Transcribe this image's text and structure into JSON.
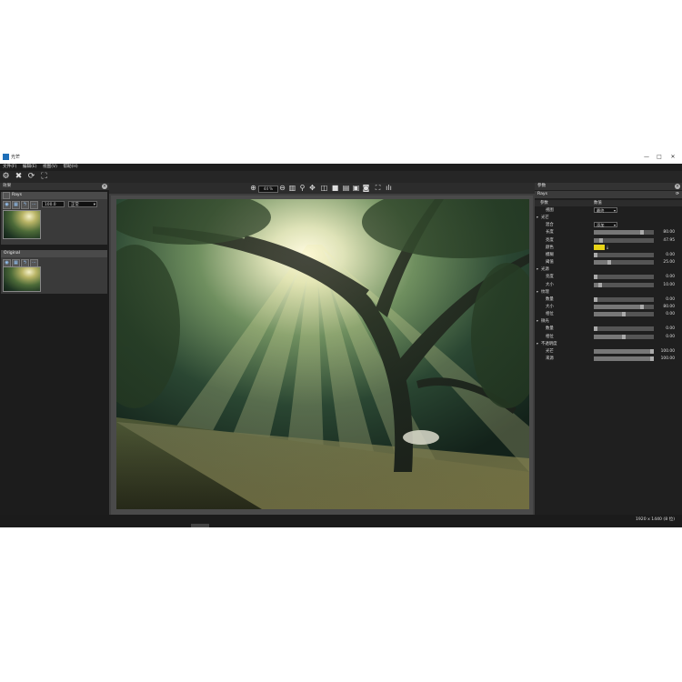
{
  "window": {
    "title": "光芒",
    "controls": {
      "minimize": "—",
      "maximize": "□",
      "close": "✕"
    }
  },
  "menu": [
    "文件(F)",
    "编辑(E)",
    "视图(V)",
    "帮助(H)"
  ],
  "effects_panel": {
    "title": "效果",
    "layers": [
      {
        "name": "Rays",
        "opacity": "100.0",
        "blend": "正常"
      },
      {
        "name": "Original"
      }
    ]
  },
  "view": {
    "zoom": "44 %"
  },
  "params_panel": {
    "title": "参数",
    "subtitle": "Rays",
    "header_left": "参数",
    "header_right": "数值",
    "rows": [
      {
        "indent": 1,
        "label": "视图",
        "type": "dropdown",
        "value": "最终"
      },
      {
        "indent": 0,
        "label": "光芒",
        "type": "group"
      },
      {
        "indent": 1,
        "label": "混合",
        "type": "dropdown",
        "value": "添加"
      },
      {
        "indent": 1,
        "label": "长度",
        "type": "slider",
        "value": "80.00",
        "pct": 0.8
      },
      {
        "indent": 1,
        "label": "亮度",
        "type": "slider",
        "value": "47.95",
        "pct": 0.12
      },
      {
        "indent": 1,
        "label": "颜色",
        "type": "color",
        "value": "#e8d417"
      },
      {
        "indent": 1,
        "label": "模糊",
        "type": "slider",
        "value": "0.00",
        "pct": 0.0
      },
      {
        "indent": 1,
        "label": "阈值",
        "type": "slider",
        "value": "25.00",
        "pct": 0.25
      },
      {
        "indent": 0,
        "label": "光源",
        "type": "group"
      },
      {
        "indent": 1,
        "label": "亮度",
        "type": "slider",
        "value": "0.00",
        "pct": 0.0
      },
      {
        "indent": 1,
        "label": "大小",
        "type": "slider",
        "value": "10.00",
        "pct": 0.1
      },
      {
        "indent": 0,
        "label": "纹理",
        "type": "group"
      },
      {
        "indent": 1,
        "label": "数量",
        "type": "slider",
        "value": "0.00",
        "pct": 0.0
      },
      {
        "indent": 1,
        "label": "大小",
        "type": "slider",
        "value": "80.00",
        "pct": 0.8
      },
      {
        "indent": 1,
        "label": "相位",
        "type": "slider",
        "value": "0.00",
        "pct": 0.5
      },
      {
        "indent": 0,
        "label": "微光",
        "type": "group"
      },
      {
        "indent": 1,
        "label": "数量",
        "type": "slider",
        "value": "0.00",
        "pct": 0.0
      },
      {
        "indent": 1,
        "label": "相位",
        "type": "slider",
        "value": "0.00",
        "pct": 0.5
      },
      {
        "indent": 0,
        "label": "不透明度",
        "type": "group"
      },
      {
        "indent": 1,
        "label": "光芒",
        "type": "slider",
        "value": "100.00",
        "pct": 1.0
      },
      {
        "indent": 1,
        "label": "来源",
        "type": "slider",
        "value": "100.00",
        "pct": 1.0
      }
    ]
  },
  "status": {
    "dimensions": "1920 x 1440 (8 位)"
  }
}
